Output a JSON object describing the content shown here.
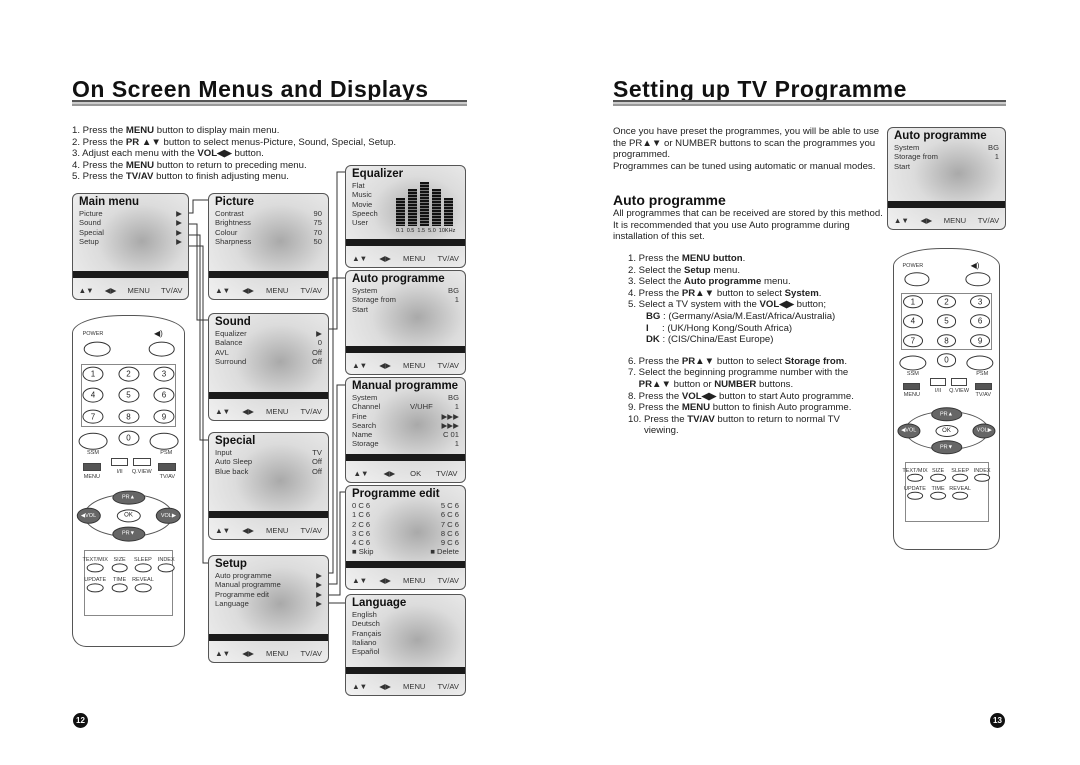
{
  "left": {
    "title": "On Screen Menus and Displays",
    "steps": [
      [
        "1. Press the ",
        "MENU",
        " button to display main menu."
      ],
      [
        "2. Press the ",
        "PR ▲▼",
        " button to select menus-Picture, Sound, Special, Setup."
      ],
      [
        "3. Adjust each menu with the ",
        "VOL◀▶",
        " button."
      ],
      [
        "4. Press the ",
        "MENU",
        " button to return to preceding menu."
      ],
      [
        "5. Press the ",
        "TV/AV",
        " button to finish adjusting menu."
      ]
    ],
    "page": "12"
  },
  "right": {
    "title": "Setting up TV Programme",
    "intro": "Once you have preset the programmes, you will be able to use the PR▲▼ or NUMBER buttons to scan the programmes you programmed.",
    "intro2": "Programmes can be tuned using automatic or manual modes.",
    "heading": "Auto programme",
    "desc": "All programmes that can be received are stored by this method. It is recommended that you use Auto programme during installation of this set.",
    "steps": [
      [
        "1. Press the ",
        "MENU button",
        "."
      ],
      [
        "2. Select the ",
        "Setup",
        " menu."
      ],
      [
        "3. Select the ",
        "Auto programme",
        " menu."
      ],
      [
        "4. Press the ",
        "PR▲▼",
        " button to select ",
        "System",
        "."
      ],
      [
        "5. Select a TV system with the ",
        "VOL◀▶",
        " button;"
      ]
    ],
    "systems": [
      [
        "BG",
        " : (Germany/Asia/M.East/Africa/Australia)"
      ],
      [
        "I",
        "     : (UK/Hong Kong/South Africa)"
      ],
      [
        "DK",
        " : (CIS/China/East Europe)"
      ]
    ],
    "steps2": [
      [
        "6. Press the ",
        "PR▲▼",
        " button to select ",
        "Storage from",
        "."
      ],
      [
        "7. Select the beginning programme number with the"
      ],
      [
        "    ",
        "PR▲▼",
        " button or ",
        "NUMBER",
        " buttons."
      ],
      [
        "8. Press the ",
        "VOL◀▶",
        " button to start Auto programme."
      ],
      [
        "9. Press the ",
        "MENU",
        " button to finish Auto programme."
      ],
      [
        "10. Press the ",
        "TV/AV",
        " button to return to normal TV"
      ],
      [
        "      viewing."
      ]
    ],
    "page": "13"
  },
  "menus": {
    "main": {
      "title": "Main menu",
      "rows": [
        [
          "Picture",
          "▶"
        ],
        [
          "Sound",
          "▶"
        ],
        [
          "Special",
          "▶"
        ],
        [
          "Setup",
          "▶"
        ]
      ],
      "footer": [
        "▲▼",
        "◀▶",
        "MENU",
        "TV/AV"
      ]
    },
    "picture": {
      "title": "Picture",
      "rows": [
        [
          "Contrast",
          "90"
        ],
        [
          "Brightness",
          "75"
        ],
        [
          "Colour",
          "70"
        ],
        [
          "Sharpness",
          "50"
        ]
      ],
      "footer": [
        "▲▼",
        "◀▶",
        "MENU",
        "TV/AV"
      ]
    },
    "sound": {
      "title": "Sound",
      "rows": [
        [
          "Equalizer",
          "▶"
        ],
        [
          "Balance",
          "0"
        ],
        [
          "AVL",
          "Off"
        ],
        [
          "Surround",
          "Off"
        ]
      ],
      "footer": [
        "▲▼",
        "◀▶",
        "MENU",
        "TV/AV"
      ]
    },
    "special": {
      "title": "Special",
      "rows": [
        [
          "Input",
          "TV"
        ],
        [
          "Auto Sleep",
          "Off"
        ],
        [
          "Blue back",
          "Off"
        ]
      ],
      "footer": [
        "▲▼",
        "◀▶",
        "MENU",
        "TV/AV"
      ]
    },
    "setup": {
      "title": "Setup",
      "rows": [
        [
          "Auto programme",
          "▶"
        ],
        [
          "Manual programme",
          "▶"
        ],
        [
          "Programme edit",
          "▶"
        ],
        [
          "Language",
          "▶"
        ]
      ],
      "footer": [
        "▲▼",
        "◀▶",
        "MENU",
        "TV/AV"
      ]
    },
    "equalizer": {
      "title": "Equalizer",
      "rows": [
        [
          "Flat"
        ],
        [
          "Music"
        ],
        [
          "Movie"
        ],
        [
          "Speech"
        ],
        [
          "User"
        ]
      ],
      "freqs": "0.1  0.5  1.5  5.0  10KHz",
      "levels": [
        0.6,
        0.8,
        0.95,
        0.8,
        0.6
      ],
      "footer": [
        "▲▼",
        "◀▶",
        "MENU",
        "TV/AV"
      ]
    },
    "auto": {
      "title": "Auto programme",
      "rows": [
        [
          "System",
          "BG"
        ],
        [
          "Storage from",
          "1"
        ],
        [
          "Start",
          ""
        ]
      ],
      "footer": [
        "▲▼",
        "◀▶",
        "MENU",
        "TV/AV"
      ]
    },
    "manual": {
      "title": "Manual programme",
      "rows": [
        [
          "System",
          "",
          "BG"
        ],
        [
          "Channel",
          "V/UHF",
          "1"
        ],
        [
          "Fine",
          "",
          "▶▶▶"
        ],
        [
          "Search",
          "",
          "▶▶▶"
        ],
        [
          "Name",
          "",
          "C  01"
        ],
        [
          "Storage",
          "",
          "1"
        ]
      ],
      "footer": [
        "▲▼",
        "◀▶",
        "OK",
        "TV/AV"
      ]
    },
    "edit": {
      "title": "Programme edit",
      "rows": [
        [
          "0  C 6",
          "5  C 6"
        ],
        [
          "1  C 6",
          "6  C 6"
        ],
        [
          "2  C 6",
          "7  C 6"
        ],
        [
          "3  C 6",
          "8  C 6"
        ],
        [
          "4  C 6",
          "9  C 6"
        ],
        [
          "■ Skip",
          "■ Delete"
        ]
      ],
      "footer": [
        "▲▼",
        "◀▶",
        "MENU",
        "TV/AV"
      ]
    },
    "language": {
      "title": "Language",
      "rows": [
        [
          "English"
        ],
        [
          "Deutsch"
        ],
        [
          "Français"
        ],
        [
          "Italiano"
        ],
        [
          "Español"
        ]
      ],
      "footer": [
        "▲▼",
        "◀▶",
        "MENU",
        "TV/AV"
      ]
    },
    "auto_right": {
      "title": "Auto programme",
      "rows": [
        [
          "System",
          "BG"
        ],
        [
          "Storage from",
          "1"
        ],
        [
          "Start",
          ""
        ]
      ],
      "footer": [
        "▲▼",
        "◀▶",
        "MENU",
        "TV/AV"
      ]
    }
  },
  "remote": {
    "power": "POWER",
    "mute": "mute-icon",
    "numbers": [
      "1",
      "2",
      "3",
      "4",
      "5",
      "6",
      "7",
      "8",
      "9",
      "0"
    ],
    "ssm": "SSM",
    "psm": "PSM",
    "menu": "MENU",
    "dual": "I/II",
    "qview": "Q.VIEW",
    "tvav": "TV/AV",
    "pr_up": "PR▲",
    "pr_down": "PR▼",
    "vol_left": "◀VOL",
    "vol_right": "VOL▶",
    "ok": "OK",
    "teletext": [
      "TEXT/MIX",
      "SIZE",
      "SLEEP",
      "INDEX",
      "UPDATE",
      "TIME",
      "REVEAL"
    ]
  }
}
